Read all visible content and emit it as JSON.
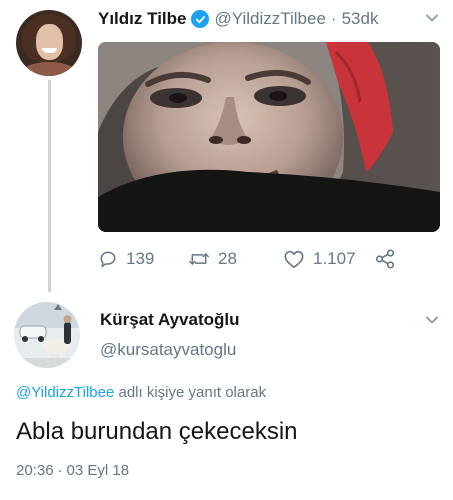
{
  "tweet": {
    "author": {
      "display_name": "Yıldız Tilbe",
      "handle": "@YildizzTilbee",
      "verified": true,
      "avatar": "user-avatar"
    },
    "separator": "·",
    "time_ago": "53dk",
    "media": "embedded-photo",
    "actions": {
      "reply_count": "139",
      "retweet_count": "28",
      "like_count": "1.107"
    }
  },
  "reply": {
    "author": {
      "display_name": "Kürşat Ayvatoğlu",
      "handle": "@kursatayvatoglu",
      "avatar": "user-avatar"
    },
    "replying_to_mention": "@YildizzTilbee",
    "replying_to_suffix": " adlı kişiye yanıt olarak",
    "text": "Abla burundan çekeceksin",
    "time": "20:36",
    "separator": "·",
    "date": "03 Eyl 18"
  },
  "colors": {
    "accent": "#1da1f2",
    "secondary_text": "#657786",
    "primary_text": "#14171a",
    "thread_line": "#c9d5de"
  },
  "icons": [
    "verified-badge-icon",
    "chevron-down-icon",
    "reply-icon",
    "retweet-icon",
    "like-icon",
    "share-icon"
  ]
}
